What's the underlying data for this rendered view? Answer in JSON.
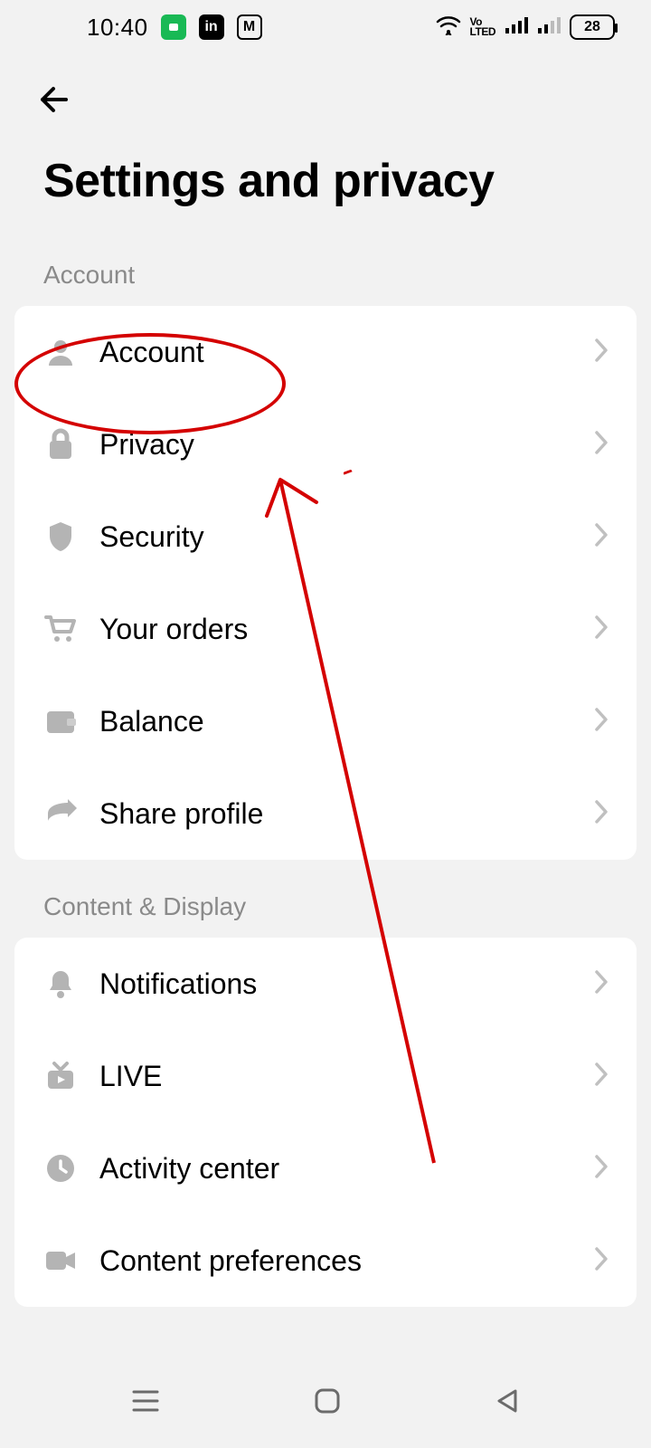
{
  "status": {
    "time": "10:40",
    "battery": "28",
    "volte": "Vo\nLTED"
  },
  "header": {
    "title": "Settings and privacy"
  },
  "sections": {
    "account": {
      "label": "Account",
      "items": [
        {
          "label": "Account"
        },
        {
          "label": "Privacy"
        },
        {
          "label": "Security"
        },
        {
          "label": "Your orders"
        },
        {
          "label": "Balance"
        },
        {
          "label": "Share profile"
        }
      ]
    },
    "content": {
      "label": "Content & Display",
      "items": [
        {
          "label": "Notifications"
        },
        {
          "label": "LIVE"
        },
        {
          "label": "Activity center"
        },
        {
          "label": "Content preferences"
        }
      ]
    }
  }
}
